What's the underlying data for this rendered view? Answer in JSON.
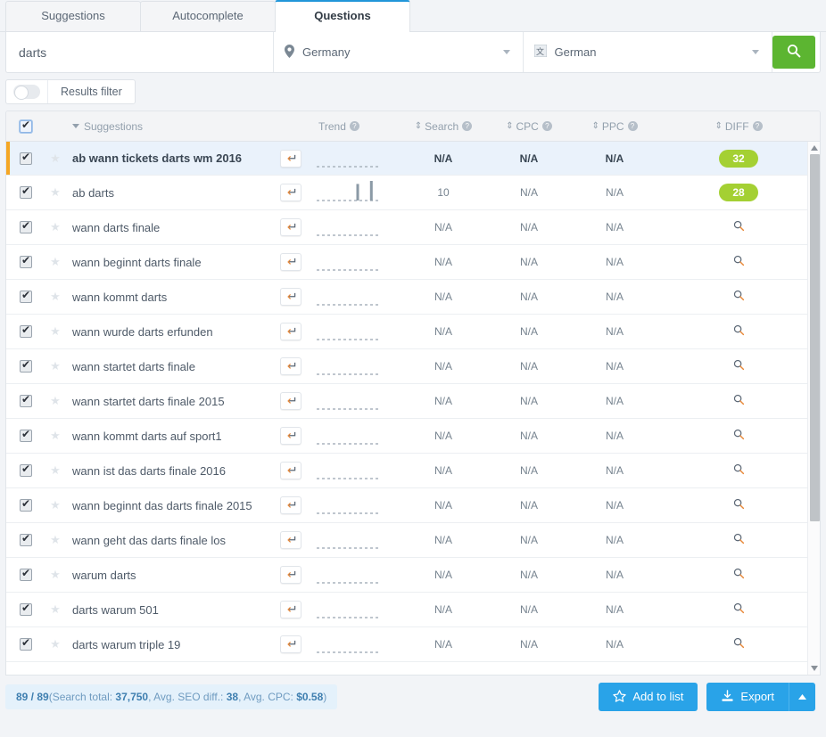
{
  "tabs": [
    {
      "label": "Suggestions",
      "active": false
    },
    {
      "label": "Autocomplete",
      "active": false
    },
    {
      "label": "Questions",
      "active": true
    }
  ],
  "search": {
    "keyword": "darts",
    "country": "Germany",
    "language": "German",
    "submit_icon": "search-icon"
  },
  "filter": {
    "label": "Results filter",
    "enabled": false
  },
  "table": {
    "headers": {
      "suggestions": "Suggestions",
      "trend": "Trend",
      "search": "Search",
      "cpc": "CPC",
      "ppc": "PPC",
      "diff": "DIFF"
    },
    "rows": [
      {
        "keyword": "ab wann tickets darts wm 2016",
        "search": "N/A",
        "cpc": "N/A",
        "ppc": "N/A",
        "diff": "32",
        "diff_type": "badge",
        "highlight": true,
        "checked": true,
        "starred": false,
        "trend": [
          0,
          0,
          0,
          0,
          0,
          0,
          0,
          0,
          0,
          0,
          0,
          0
        ]
      },
      {
        "keyword": "ab darts",
        "search": "10",
        "cpc": "N/A",
        "ppc": "N/A",
        "diff": "28",
        "diff_type": "badge",
        "highlight": false,
        "checked": true,
        "starred": false,
        "trend": [
          0,
          0,
          0,
          0,
          0,
          0,
          22,
          0,
          26,
          0,
          0,
          0
        ]
      },
      {
        "keyword": "wann darts finale",
        "search": "N/A",
        "cpc": "N/A",
        "ppc": "N/A",
        "diff": "",
        "diff_type": "search",
        "highlight": false,
        "checked": true,
        "starred": false,
        "trend": [
          0,
          0,
          0,
          0,
          0,
          0,
          0,
          0,
          0,
          0,
          0,
          0
        ]
      },
      {
        "keyword": "wann beginnt darts finale",
        "search": "N/A",
        "cpc": "N/A",
        "ppc": "N/A",
        "diff": "",
        "diff_type": "search",
        "highlight": false,
        "checked": true,
        "starred": false,
        "trend": [
          0,
          0,
          0,
          0,
          0,
          0,
          0,
          0,
          0,
          0,
          0,
          0
        ]
      },
      {
        "keyword": "wann kommt darts",
        "search": "N/A",
        "cpc": "N/A",
        "ppc": "N/A",
        "diff": "",
        "diff_type": "search",
        "highlight": false,
        "checked": true,
        "starred": false,
        "trend": [
          0,
          0,
          0,
          0,
          0,
          0,
          0,
          0,
          0,
          0,
          0,
          0
        ]
      },
      {
        "keyword": "wann wurde darts erfunden",
        "search": "N/A",
        "cpc": "N/A",
        "ppc": "N/A",
        "diff": "",
        "diff_type": "search",
        "highlight": false,
        "checked": true,
        "starred": false,
        "trend": [
          0,
          0,
          0,
          0,
          0,
          0,
          0,
          0,
          0,
          0,
          0,
          0
        ]
      },
      {
        "keyword": "wann startet darts finale",
        "search": "N/A",
        "cpc": "N/A",
        "ppc": "N/A",
        "diff": "",
        "diff_type": "search",
        "highlight": false,
        "checked": true,
        "starred": false,
        "trend": [
          0,
          0,
          0,
          0,
          0,
          0,
          0,
          0,
          0,
          0,
          0,
          0
        ]
      },
      {
        "keyword": "wann startet darts finale 2015",
        "search": "N/A",
        "cpc": "N/A",
        "ppc": "N/A",
        "diff": "",
        "diff_type": "search",
        "highlight": false,
        "checked": true,
        "starred": false,
        "trend": [
          0,
          0,
          0,
          0,
          0,
          0,
          0,
          0,
          0,
          0,
          0,
          0
        ]
      },
      {
        "keyword": "wann kommt darts auf sport1",
        "search": "N/A",
        "cpc": "N/A",
        "ppc": "N/A",
        "diff": "",
        "diff_type": "search",
        "highlight": false,
        "checked": true,
        "starred": false,
        "trend": [
          0,
          0,
          0,
          0,
          0,
          0,
          0,
          0,
          0,
          0,
          0,
          0
        ]
      },
      {
        "keyword": "wann ist das darts finale 2016",
        "search": "N/A",
        "cpc": "N/A",
        "ppc": "N/A",
        "diff": "",
        "diff_type": "search",
        "highlight": false,
        "checked": true,
        "starred": false,
        "trend": [
          0,
          0,
          0,
          0,
          0,
          0,
          0,
          0,
          0,
          0,
          0,
          0
        ]
      },
      {
        "keyword": "wann beginnt das darts finale 2015",
        "search": "N/A",
        "cpc": "N/A",
        "ppc": "N/A",
        "diff": "",
        "diff_type": "search",
        "highlight": false,
        "checked": true,
        "starred": false,
        "trend": [
          0,
          0,
          0,
          0,
          0,
          0,
          0,
          0,
          0,
          0,
          0,
          0
        ]
      },
      {
        "keyword": "wann geht das darts finale los",
        "search": "N/A",
        "cpc": "N/A",
        "ppc": "N/A",
        "diff": "",
        "diff_type": "search",
        "highlight": false,
        "checked": true,
        "starred": false,
        "trend": [
          0,
          0,
          0,
          0,
          0,
          0,
          0,
          0,
          0,
          0,
          0,
          0
        ]
      },
      {
        "keyword": "warum darts",
        "search": "N/A",
        "cpc": "N/A",
        "ppc": "N/A",
        "diff": "",
        "diff_type": "search",
        "highlight": false,
        "checked": true,
        "starred": false,
        "trend": [
          0,
          0,
          0,
          0,
          0,
          0,
          0,
          0,
          0,
          0,
          0,
          0
        ]
      },
      {
        "keyword": "darts warum 501",
        "search": "N/A",
        "cpc": "N/A",
        "ppc": "N/A",
        "diff": "",
        "diff_type": "search",
        "highlight": false,
        "checked": true,
        "starred": false,
        "trend": [
          0,
          0,
          0,
          0,
          0,
          0,
          0,
          0,
          0,
          0,
          0,
          0
        ]
      },
      {
        "keyword": "darts warum triple 19",
        "search": "N/A",
        "cpc": "N/A",
        "ppc": "N/A",
        "diff": "",
        "diff_type": "search",
        "highlight": false,
        "checked": true,
        "starred": false,
        "trend": [
          0,
          0,
          0,
          0,
          0,
          0,
          0,
          0,
          0,
          0,
          0,
          0
        ]
      }
    ]
  },
  "footer": {
    "counts": "89 / 89",
    "stats_prefix": "(Search total: ",
    "search_total": "37,750",
    "seo_label": ",  Avg. SEO diff.: ",
    "seo_value": "38",
    "cpc_label": ",  Avg. CPC: ",
    "cpc_value": "$0.58",
    "stats_suffix": ")",
    "add_to_list": "Add to list",
    "export": "Export"
  },
  "colors": {
    "accent_blue": "#29a3e8",
    "tab_active": "#2196d9",
    "green_button": "#5cb531",
    "badge_green": "#a4d033",
    "row_highlight_bar": "#f5a623",
    "row_highlight_bg": "#eaf2fb"
  }
}
